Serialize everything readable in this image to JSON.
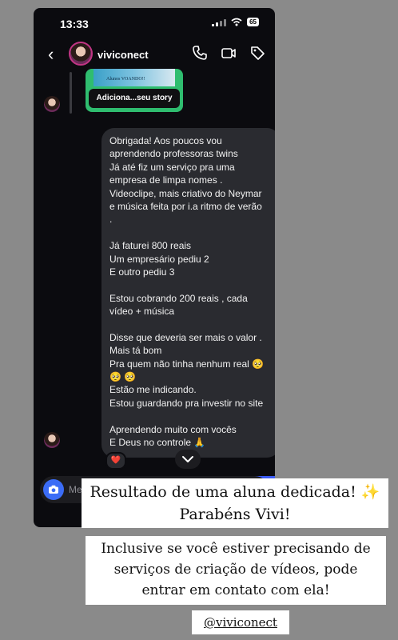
{
  "status_bar": {
    "time": "13:33",
    "battery": "65"
  },
  "header": {
    "username": "viviconect"
  },
  "story_reply": {
    "thumbnail_text": "Alunos VOANDO!!",
    "label": "Adiciona...seu story"
  },
  "message": {
    "lines": [
      "Obrigada! Aos poucos vou",
      "aprendendo professoras twins",
      "Já até fiz um serviço pra uma",
      "empresa de limpa nomes .",
      "Videoclipe, mais criativo do Neymar",
      "e música feita por i.a ritmo de verão",
      ".",
      "",
      "Já faturei 800 reais",
      "Um empresário pediu 2",
      "E outro pediu 3",
      "",
      "Estou cobrando 200 reais , cada",
      "vídeo + música",
      "",
      "Disse que deveria ser mais o valor .",
      "Mais tá bom",
      "Pra quem não tinha nenhum real 🥺",
      "🥺 🥺",
      "Estão me indicando.",
      "Estou guardando pra investir no site",
      "",
      "Aprendendo muito com vocês",
      "E Deus no controle 🙏"
    ],
    "reaction": "❤️"
  },
  "composer": {
    "placeholder": "Me"
  },
  "captions": {
    "line1a": "Resultado de uma aluna dedicada! ",
    "sparkles": "✨",
    "line1b": "Parabéns Vivi!",
    "line2a": "Inclusive se você estiver precisando de",
    "line2b": "serviços de criação de vídeos, pode",
    "line2c": "entrar em contato com ela!",
    "handle": "@viviconect"
  },
  "colors": {
    "accent_blue": "#3b5bf5",
    "story_green": "#2fbd6f",
    "bubble_gray": "#2a2b30"
  }
}
